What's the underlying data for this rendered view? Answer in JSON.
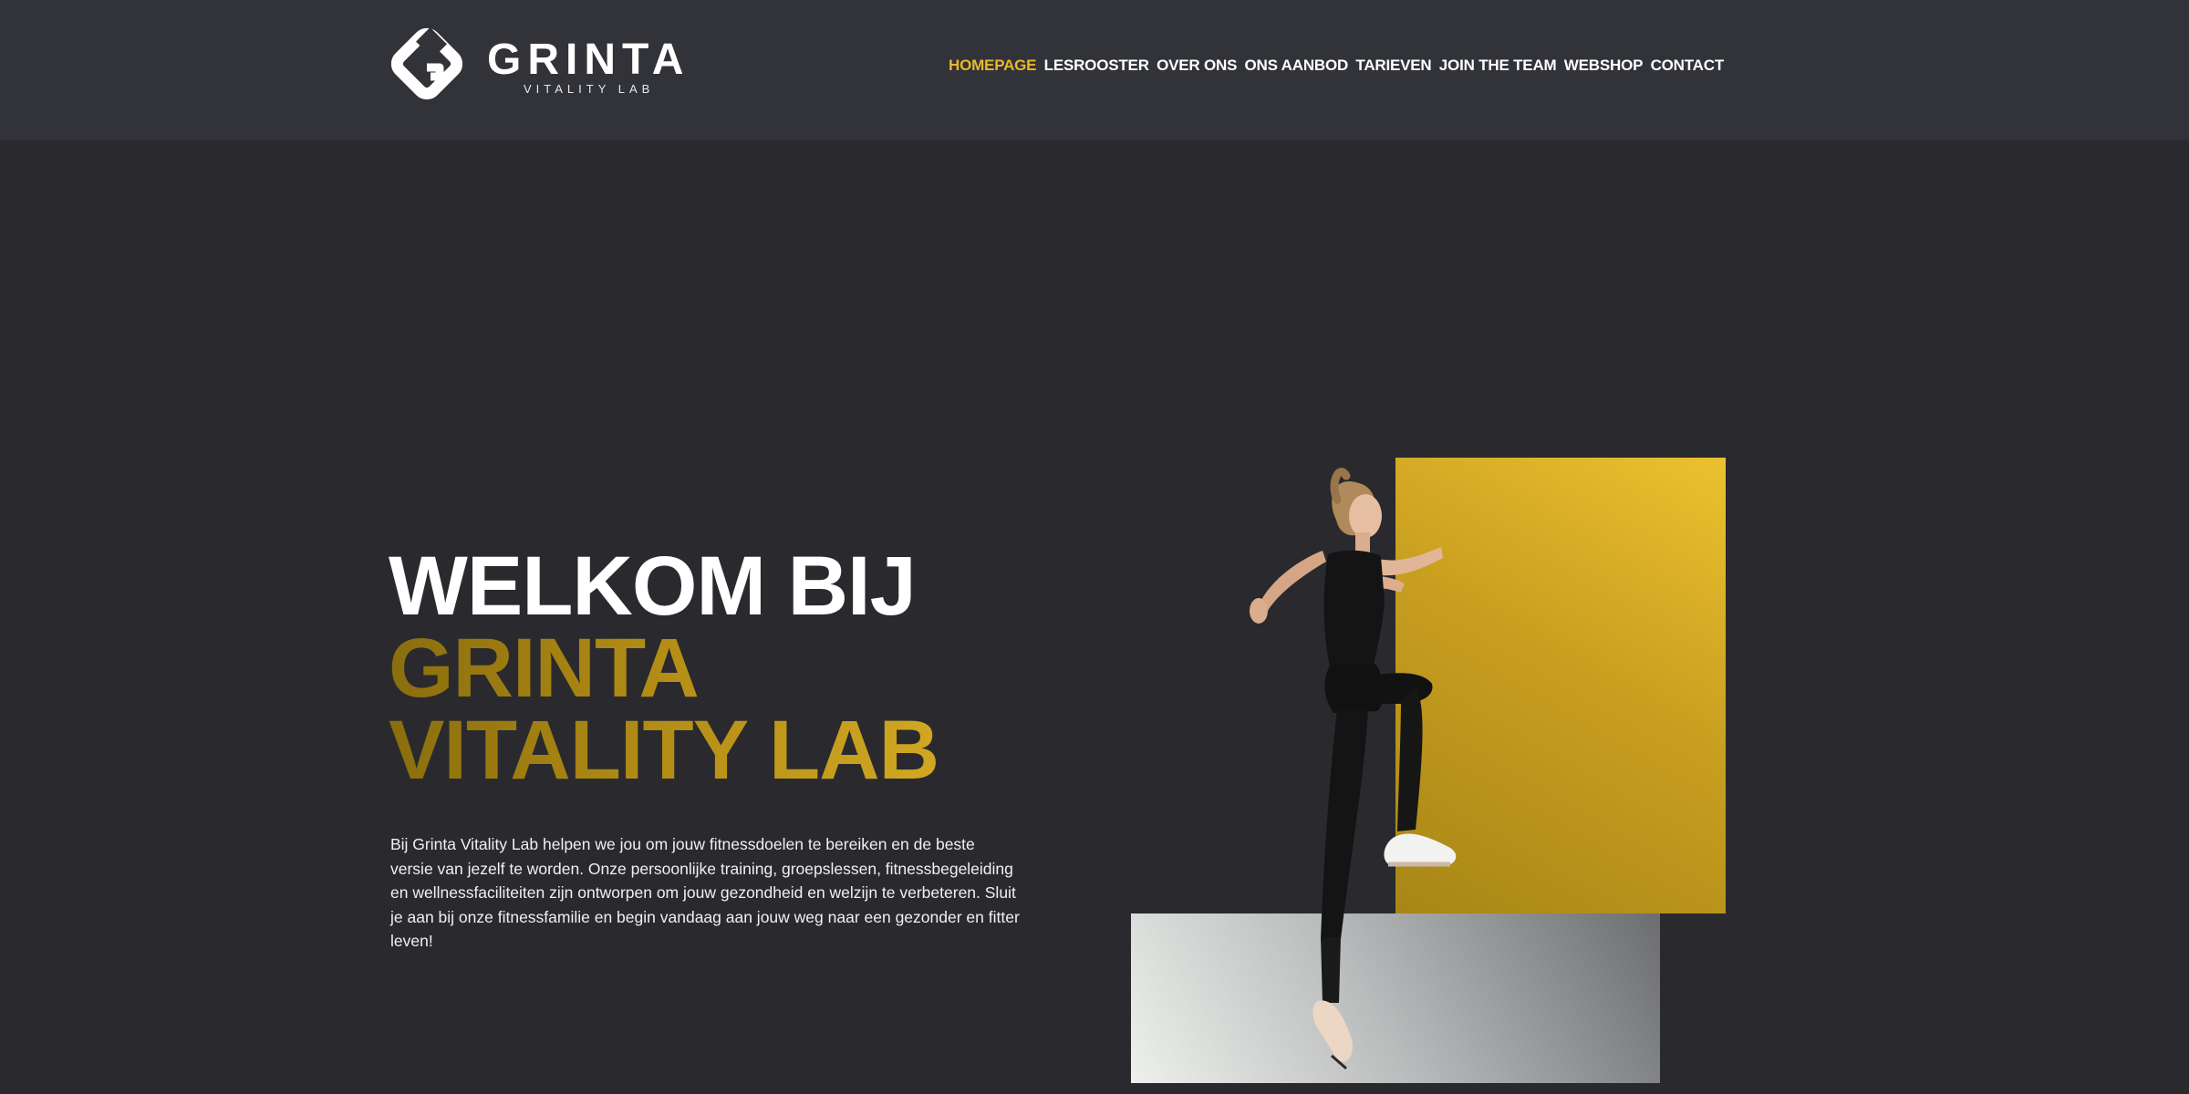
{
  "brand": {
    "name": "GRINTA",
    "tagline": "VITALITY LAB"
  },
  "nav": {
    "items": [
      {
        "label": "HOMEPAGE",
        "active": true
      },
      {
        "label": "LESROOSTER",
        "active": false
      },
      {
        "label": "OVER ONS",
        "active": false
      },
      {
        "label": "ONS AANBOD",
        "active": false
      },
      {
        "label": "TARIEVEN",
        "active": false
      },
      {
        "label": "JOIN THE TEAM",
        "active": false
      },
      {
        "label": "WEBSHOP",
        "active": false
      },
      {
        "label": "CONTACT",
        "active": false
      }
    ]
  },
  "hero": {
    "title_line1": "WELKOM BIJ",
    "title_line2": "GRINTA",
    "title_line3": "VITALITY LAB",
    "body": "Bij Grinta Vitality Lab helpen we jou om jouw fitnessdoelen te bereiken en de beste versie van jezelf te worden. Onze persoonlijke training, groepslessen, fitnessbegeleiding en wellnessfaciliteiten zijn ontworpen om jouw gezondheid en welzijn te verbeteren. Sluit je aan bij onze fitnessfamilie en begin vandaag aan jouw weg naar een gezonder en fitter leven!"
  },
  "colors": {
    "header_bg": "#323338",
    "page_bg": "#2a2a2e",
    "accent": "#e8b72a",
    "gold": "#c29a1c"
  },
  "images": {
    "hero_photo": "woman-running-athlete-illustration"
  }
}
